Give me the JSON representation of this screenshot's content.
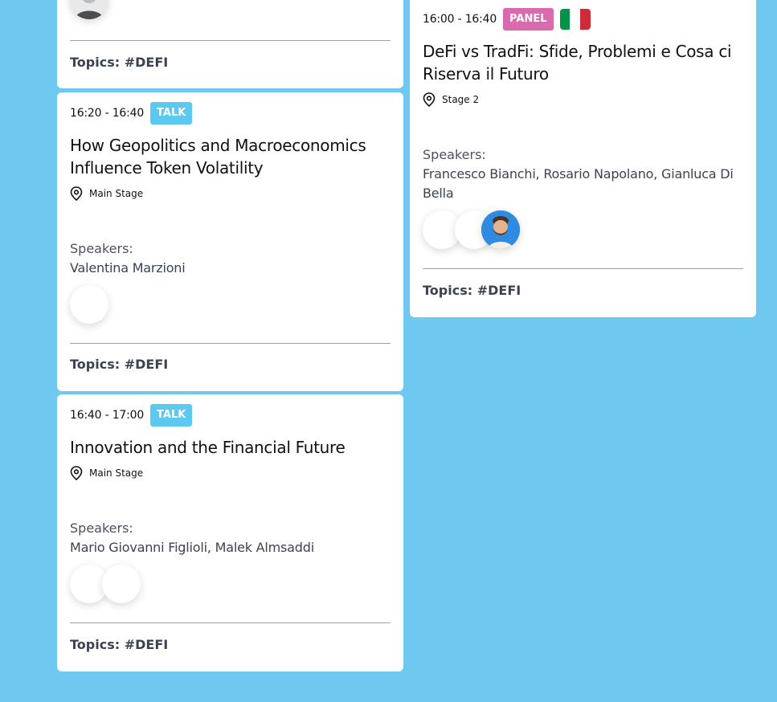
{
  "cards": {
    "top": {
      "topics": "Topics: #DEFI"
    },
    "geo": {
      "time": "16:20 - 16:40",
      "type": "TALK",
      "title": "How Geopolitics and Macroeconomics Influence Token Volatility",
      "location": "Main Stage",
      "speakers_label": "Speakers:",
      "speakers": "Valentina Marzioni",
      "topics": "Topics: #DEFI"
    },
    "innovation": {
      "time": "16:40 - 17:00",
      "type": "TALK",
      "title": "Innovation and the Financial Future",
      "location": "Main Stage",
      "speakers_label": "Speakers:",
      "speakers": "Mario Giovanni Figlioli, Malek Almsaddi",
      "topics": "Topics: #DEFI"
    },
    "defi": {
      "time": "16:00 - 16:40",
      "type": "PANEL",
      "language_flag": "italy-flag-icon",
      "title": "DeFi vs TradFi: Sfide, Problemi e Cosa ci Riserva il Futuro",
      "location": "Stage 2",
      "speakers_label": "Speakers:",
      "speakers": "Francesco Bianchi, Rosario Napolano, Gianluca Di Bella",
      "topics": "Topics: #DEFI"
    }
  },
  "colors": {
    "background": "#6ec8f0",
    "talk_badge": "#5bc9f0",
    "panel_badge": "#d96aad",
    "flag_green": "#009246",
    "flag_white": "#ffffff",
    "flag_red": "#ce2b37"
  }
}
